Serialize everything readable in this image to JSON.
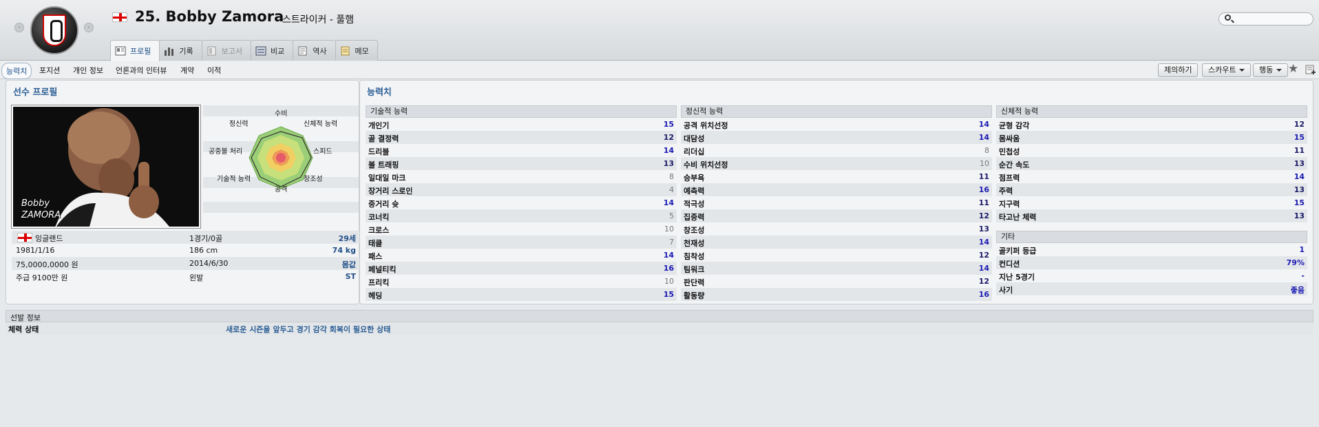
{
  "header": {
    "title": "25. Bobby Zamora",
    "subtitle": "스트라이커 - 풀햄",
    "tabs": [
      {
        "label": "프로필",
        "icon": "profile-icon",
        "state": "active"
      },
      {
        "label": "기록",
        "icon": "stats-icon",
        "state": "normal"
      },
      {
        "label": "보고서",
        "icon": "report-icon",
        "state": "disabled"
      },
      {
        "label": "비교",
        "icon": "compare-icon",
        "state": "normal"
      },
      {
        "label": "역사",
        "icon": "history-icon",
        "state": "normal"
      },
      {
        "label": "메모",
        "icon": "notes-icon",
        "state": "normal"
      }
    ]
  },
  "subnav": {
    "items": [
      "능력치",
      "포지션",
      "개인 정보",
      "언론과의 인터뷰",
      "계약",
      "이적"
    ],
    "buttons": {
      "offer": "제의하기",
      "scout": "스카우트",
      "action": "행동"
    }
  },
  "profile": {
    "title": "선수 프로필",
    "photo_caption_line1": "Bobby",
    "photo_caption_line2": "ZAMORA",
    "radar_labels": {
      "top": "수비",
      "top_left": "정신력",
      "top_right": "신체적 능력",
      "left": "공중볼 처리",
      "right": "스피드",
      "bottom_left": "기술적 능력",
      "bottom_right": "창조성",
      "bottom": "공격"
    },
    "rows": [
      {
        "left": "잉글랜드",
        "mid": "1경기/0골",
        "right": "29세"
      },
      {
        "left": "1981/1/16",
        "mid": "186 cm",
        "right": "74 kg"
      },
      {
        "left": "75,0000,0000 원",
        "mid": "2014/6/30",
        "right": "몸값"
      },
      {
        "left": "주급 9100만 원",
        "mid": "왼발",
        "right": "ST"
      }
    ]
  },
  "attributes": {
    "title": "능력치",
    "technical": {
      "header": "기술적 능력",
      "items": [
        {
          "name": "개인기",
          "value": "15"
        },
        {
          "name": "골 결정력",
          "value": "12"
        },
        {
          "name": "드리블",
          "value": "14"
        },
        {
          "name": "볼 트래핑",
          "value": "13"
        },
        {
          "name": "일대일 마크",
          "value": "8"
        },
        {
          "name": "장거리 스로인",
          "value": "4"
        },
        {
          "name": "중거리 슛",
          "value": "14"
        },
        {
          "name": "코너킥",
          "value": "5"
        },
        {
          "name": "크로스",
          "value": "10"
        },
        {
          "name": "태클",
          "value": "7"
        },
        {
          "name": "패스",
          "value": "14"
        },
        {
          "name": "페널티킥",
          "value": "16"
        },
        {
          "name": "프리킥",
          "value": "10"
        },
        {
          "name": "헤딩",
          "value": "15"
        }
      ]
    },
    "mental": {
      "header": "정신적 능력",
      "items": [
        {
          "name": "공격 위치선정",
          "value": "14"
        },
        {
          "name": "대담성",
          "value": "14"
        },
        {
          "name": "리더십",
          "value": "8"
        },
        {
          "name": "수비 위치선정",
          "value": "10"
        },
        {
          "name": "승부욕",
          "value": "11"
        },
        {
          "name": "예측력",
          "value": "16"
        },
        {
          "name": "적극성",
          "value": "11"
        },
        {
          "name": "집중력",
          "value": "12"
        },
        {
          "name": "창조성",
          "value": "13"
        },
        {
          "name": "천재성",
          "value": "14"
        },
        {
          "name": "침착성",
          "value": "12"
        },
        {
          "name": "팀워크",
          "value": "14"
        },
        {
          "name": "판단력",
          "value": "12"
        },
        {
          "name": "활동량",
          "value": "16"
        }
      ]
    },
    "physical": {
      "header": "신체적 능력",
      "items": [
        {
          "name": "균형 감각",
          "value": "12"
        },
        {
          "name": "몸싸움",
          "value": "15"
        },
        {
          "name": "민첩성",
          "value": "11"
        },
        {
          "name": "순간 속도",
          "value": "13"
        },
        {
          "name": "점프력",
          "value": "14"
        },
        {
          "name": "주력",
          "value": "13"
        },
        {
          "name": "지구력",
          "value": "15"
        },
        {
          "name": "타고난 체력",
          "value": "13"
        }
      ]
    },
    "other": {
      "header": "기타",
      "items": [
        {
          "name": "골키퍼 등급",
          "value": "1"
        },
        {
          "name": "컨디션",
          "value": "79%"
        },
        {
          "name": "지난 5경기",
          "value": "-"
        },
        {
          "name": "사기",
          "value": "좋음"
        }
      ]
    }
  },
  "selection": {
    "header": "선발 정보",
    "label": "체력 상태",
    "value": "새로운 시즌을 앞두고 경기 감각 회복이 필요한 상태"
  },
  "colors": {
    "accent": "#2a5d94",
    "value_high": "#1a1ab2",
    "value_low": "#777777"
  }
}
